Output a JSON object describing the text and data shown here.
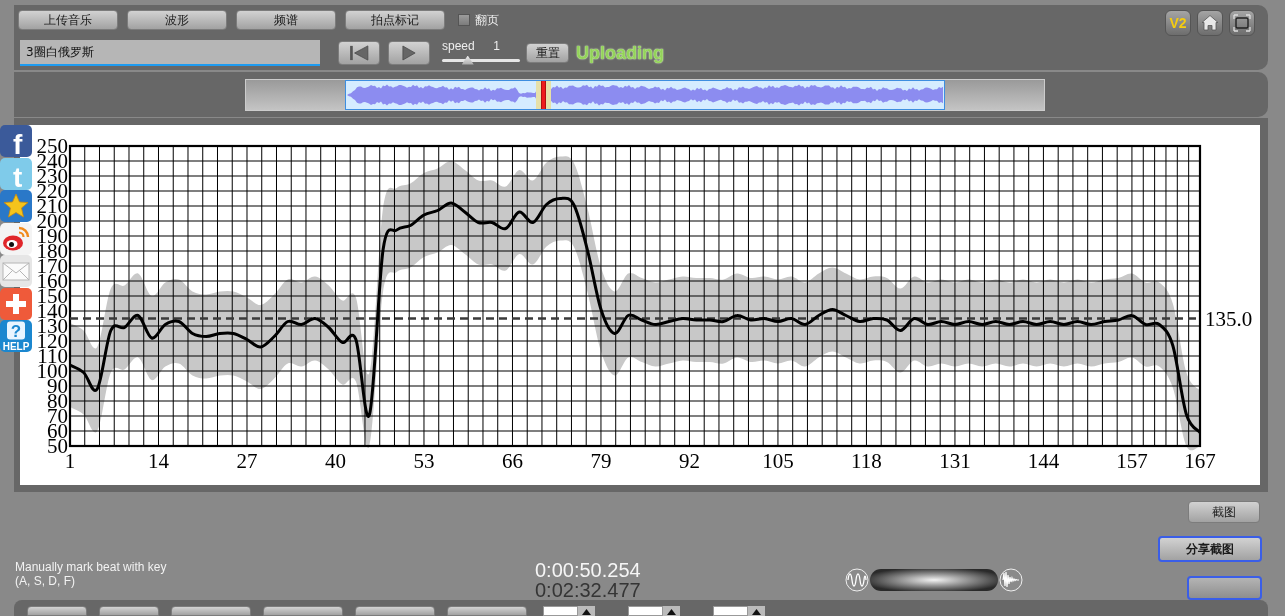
{
  "toolbar": {
    "buttons": [
      {
        "label": "上传音乐"
      },
      {
        "label": "波形"
      },
      {
        "label": "频谱"
      },
      {
        "label": "拍点标记"
      }
    ],
    "page_flip": {
      "label": "翻页",
      "checked": false
    },
    "version_badge": "V2"
  },
  "player": {
    "title": "3圈白俄罗斯",
    "speed_label": "speed",
    "speed_value": "1",
    "speed": {
      "level": 0.33
    },
    "reset_button": "重置",
    "status": "Uploading"
  },
  "overview": {
    "level": 0.33
  },
  "chart": {
    "chart_data": {
      "type": "line",
      "x": [
        1,
        3,
        5,
        7,
        9,
        11,
        13,
        15,
        17,
        19,
        21,
        23,
        25,
        27,
        29,
        31,
        33,
        35,
        37,
        39,
        41,
        43,
        45,
        47,
        49,
        51,
        53,
        55,
        57,
        59,
        61,
        63,
        65,
        67,
        69,
        71,
        73,
        75,
        77,
        79,
        81,
        83,
        85,
        87,
        89,
        91,
        93,
        95,
        97,
        99,
        101,
        103,
        105,
        107,
        109,
        111,
        113,
        115,
        117,
        119,
        121,
        123,
        125,
        127,
        129,
        131,
        133,
        135,
        137,
        139,
        141,
        143,
        145,
        147,
        149,
        151,
        153,
        155,
        157,
        159,
        161,
        163,
        165,
        167
      ],
      "series": [
        {
          "color": "#000000",
          "values": [
            104,
            99,
            88,
            127,
            129,
            137,
            122,
            131,
            133,
            125,
            123,
            125,
            125,
            121,
            116,
            123,
            133,
            131,
            135,
            129,
            119,
            121,
            71,
            181,
            194,
            197,
            204,
            207,
            212,
            206,
            199,
            199,
            195,
            206,
            199,
            211,
            215,
            211,
            181,
            141,
            125,
            137,
            134,
            131,
            133,
            135,
            134,
            134,
            133,
            137,
            134,
            135,
            133,
            135,
            131,
            137,
            141,
            137,
            133,
            135,
            134,
            127,
            135,
            131,
            133,
            131,
            133,
            131,
            133,
            131,
            133,
            131,
            133,
            131,
            133,
            131,
            133,
            134,
            137,
            131,
            131,
            117,
            71,
            59
          ]
        }
      ],
      "xlim": [
        1,
        167
      ],
      "ylim": [
        50,
        250
      ],
      "xticks": [
        1,
        14,
        27,
        40,
        53,
        66,
        79,
        92,
        105,
        118,
        131,
        144,
        157,
        167
      ],
      "yticks": [
        50,
        60,
        70,
        80,
        90,
        100,
        110,
        120,
        130,
        140,
        150,
        160,
        170,
        180,
        190,
        200,
        210,
        220,
        230,
        240,
        250
      ],
      "grid": true,
      "ref_lines": [
        {
          "axis": "y",
          "value": 135,
          "label": "135.0"
        }
      ]
    }
  },
  "share_bar": [
    {
      "kind": "letter",
      "glyph": "f",
      "color": "#3b5a9a"
    },
    {
      "kind": "letter",
      "glyph": "t",
      "color": "#7fcbea"
    },
    {
      "kind": "star",
      "color": "#2a78c8"
    },
    {
      "kind": "swirl",
      "color": "#f4f4f4"
    },
    {
      "kind": "envelope",
      "color": "#e6e6e6"
    },
    {
      "kind": "plus",
      "color": "#ef5a3a"
    },
    {
      "kind": "question",
      "glyph": "?",
      "caption": "HELP",
      "color": "#1b87cf"
    }
  ],
  "footer": {
    "hint": "Manually mark beat with key\n(A, S, D, F)",
    "current_time": "0:00:50.254",
    "total_time": "0:02:32.477",
    "buttons": [
      {
        "label": "截图",
        "highlighted": false,
        "disabled": false
      },
      {
        "label": "分享截图",
        "highlighted": true,
        "disabled": false
      },
      {
        "highlighted": true,
        "disabled": true
      }
    ]
  }
}
